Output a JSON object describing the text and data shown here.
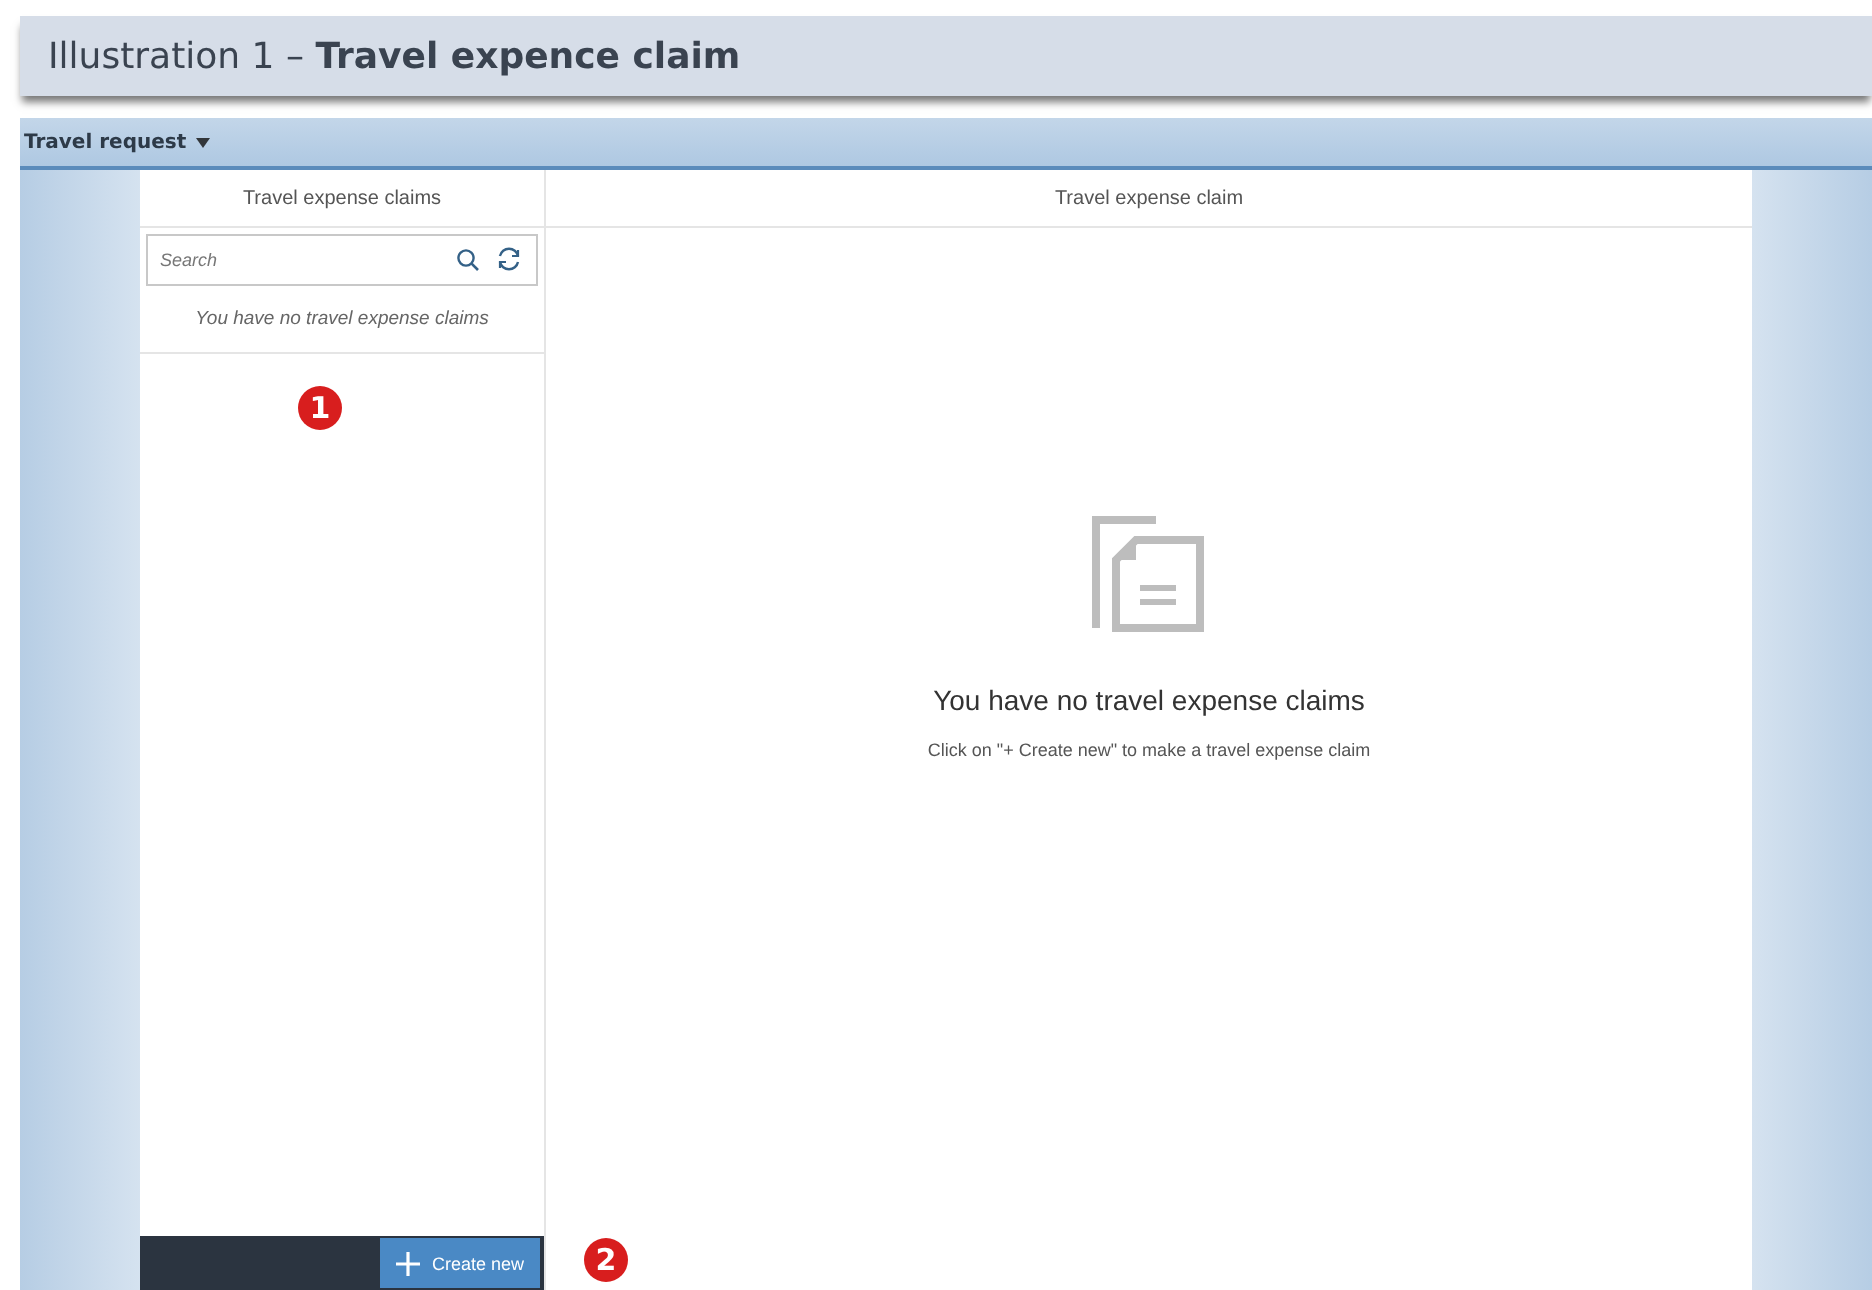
{
  "caption": "Illustration 1 – **Travel expence claim**",
  "shell": {
    "title": "Travel request"
  },
  "list_panel": {
    "title": "Travel expense claims",
    "search": {
      "placeholder": "Search"
    },
    "empty_text": "You have no travel expense claims",
    "create_button": "Create new"
  },
  "detail_panel": {
    "title": "Travel expense claim",
    "empty_title": "You have no travel expense claims",
    "empty_hint": "Click on \"+ Create new\" to make a travel expense claim"
  },
  "markers": [
    {
      "label": "1"
    },
    {
      "label": "2"
    }
  ]
}
